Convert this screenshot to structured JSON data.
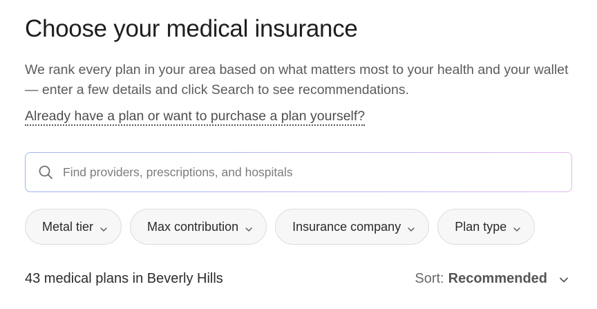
{
  "header": {
    "title": "Choose your medical insurance",
    "intro": "We rank every plan in your area based on what matters most to your health and your wallet — enter a few details and click Search to see recommendations.",
    "existing_plan_link": "Already have a plan or want to purchase a plan yourself?"
  },
  "search": {
    "placeholder": "Find providers, prescriptions, and hospitals",
    "value": "",
    "icon": "search-icon"
  },
  "filters": [
    {
      "label": "Metal tier",
      "icon": "chevron-down-icon"
    },
    {
      "label": "Max contribution",
      "icon": "chevron-down-icon"
    },
    {
      "label": "Insurance company",
      "icon": "chevron-down-icon"
    },
    {
      "label": "Plan type",
      "icon": "chevron-down-icon"
    }
  ],
  "results": {
    "count_text": "43 medical plans in Beverly Hills"
  },
  "sort": {
    "label": "Sort:",
    "value": "Recommended",
    "icon": "chevron-down-icon"
  }
}
